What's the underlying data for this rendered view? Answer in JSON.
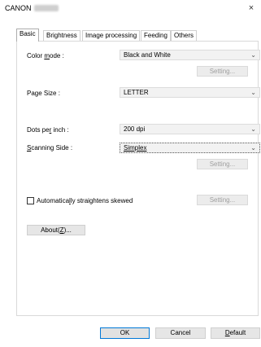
{
  "window": {
    "title": "CANON",
    "close_glyph": "×"
  },
  "tabs": [
    {
      "label": "Basic",
      "active": true
    },
    {
      "label": "Brightness",
      "active": false
    },
    {
      "label": "Image processing",
      "active": false
    },
    {
      "label": "Feeding",
      "active": false
    },
    {
      "label": "Others",
      "active": false
    }
  ],
  "color_mode": {
    "label_pre": "Color ",
    "label_u": "m",
    "label_post": "ode :",
    "value": "Black and White",
    "setting_label": "Setting..."
  },
  "page_size": {
    "label": "Page Size :",
    "value": "LETTER"
  },
  "dpi": {
    "label_pre": "Dots pe",
    "label_u": "r",
    "label_post": " inch :",
    "value": "200 dpi"
  },
  "scanning_side": {
    "label_u": "S",
    "label_post": "canning Side :",
    "value": "Simplex",
    "setting_label": "Setting..."
  },
  "auto_straighten": {
    "label_pre": "Automatica",
    "label_u": "l",
    "label_post": "ly straightens skewed",
    "checked": false,
    "setting_label": "Setting..."
  },
  "about_button": {
    "label_pre": "About(",
    "label_u": "Z",
    "label_post": ")..."
  },
  "footer": {
    "ok_label": "OK",
    "cancel_label": "Cancel",
    "default_u": "D",
    "default_post": "efault"
  },
  "arrow_glyph": "⌄"
}
